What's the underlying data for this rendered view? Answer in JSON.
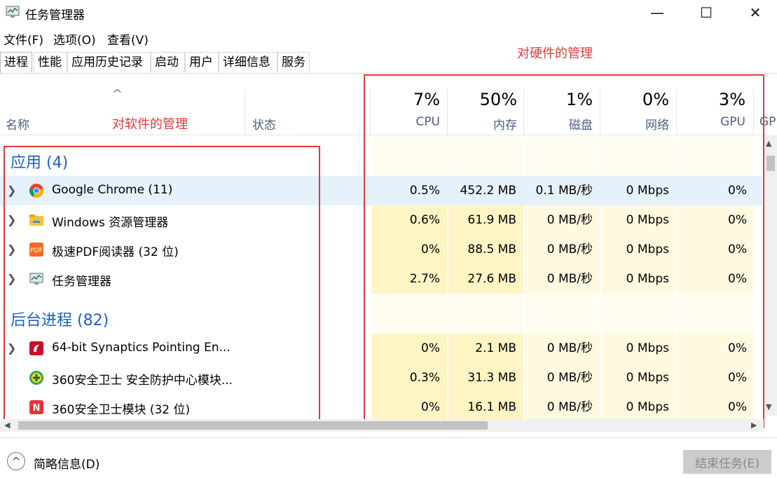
{
  "window": {
    "title": "任务管理器",
    "controls": {
      "minimize": "—",
      "maximize": "☐",
      "close": "✕"
    }
  },
  "menu": [
    "文件(F)",
    "选项(O)",
    "查看(V)"
  ],
  "tabs": [
    "进程",
    "性能",
    "应用历史记录",
    "启动",
    "用户",
    "详细信息",
    "服务"
  ],
  "columns": {
    "sort_indicator": "^",
    "name": "名称",
    "status": "状态",
    "cpu": {
      "pct": "7%",
      "label": "CPU"
    },
    "memory": {
      "pct": "50%",
      "label": "内存"
    },
    "disk": {
      "pct": "1%",
      "label": "磁盘"
    },
    "network": {
      "pct": "0%",
      "label": "网络"
    },
    "gpu": {
      "pct": "3%",
      "label": "GPU"
    },
    "gpu_engine_partial": "GP"
  },
  "annotations": {
    "software": "对软件的管理",
    "hardware": "对硬件的管理"
  },
  "groups": {
    "apps": "应用 (4)",
    "background": "后台进程 (82)"
  },
  "apps": [
    {
      "name": "Google Chrome (11)",
      "cpu": "0.5%",
      "mem": "452.2 MB",
      "disk": "0.1 MB/秒",
      "net": "0 Mbps",
      "gpu": "0%",
      "icon": "chrome-icon"
    },
    {
      "name": "Windows 资源管理器",
      "cpu": "0.6%",
      "mem": "61.9 MB",
      "disk": "0 MB/秒",
      "net": "0 Mbps",
      "gpu": "0%",
      "icon": "folder-icon"
    },
    {
      "name": "极速PDF阅读器 (32 位)",
      "cpu": "0%",
      "mem": "88.5 MB",
      "disk": "0 MB/秒",
      "net": "0 Mbps",
      "gpu": "0%",
      "icon": "pdf-icon"
    },
    {
      "name": "任务管理器",
      "cpu": "2.7%",
      "mem": "27.6 MB",
      "disk": "0 MB/秒",
      "net": "0 Mbps",
      "gpu": "0%",
      "icon": "task-manager-icon"
    }
  ],
  "background": [
    {
      "name": "64-bit Synaptics Pointing En...",
      "cpu": "0%",
      "mem": "2.1 MB",
      "disk": "0 MB/秒",
      "net": "0 Mbps",
      "gpu": "0%",
      "icon": "synaptics-icon"
    },
    {
      "name": "360安全卫士 安全防护中心模块...",
      "cpu": "0.3%",
      "mem": "31.3 MB",
      "disk": "0 MB/秒",
      "net": "0 Mbps",
      "gpu": "0%",
      "icon": "360-plus-icon"
    },
    {
      "name": "360安全卫士模块 (32 位)",
      "cpu": "0%",
      "mem": "16.1 MB",
      "disk": "0 MB/秒",
      "net": "0 Mbps",
      "gpu": "0%",
      "icon": "360-shield-icon"
    }
  ],
  "footer": {
    "collapse_glyph": "^",
    "brief_info": "简略信息(D)",
    "end_task": "结束任务(E)"
  },
  "scroll": {
    "up": "▲",
    "down": "▼",
    "left": "◀",
    "right": "▶"
  }
}
